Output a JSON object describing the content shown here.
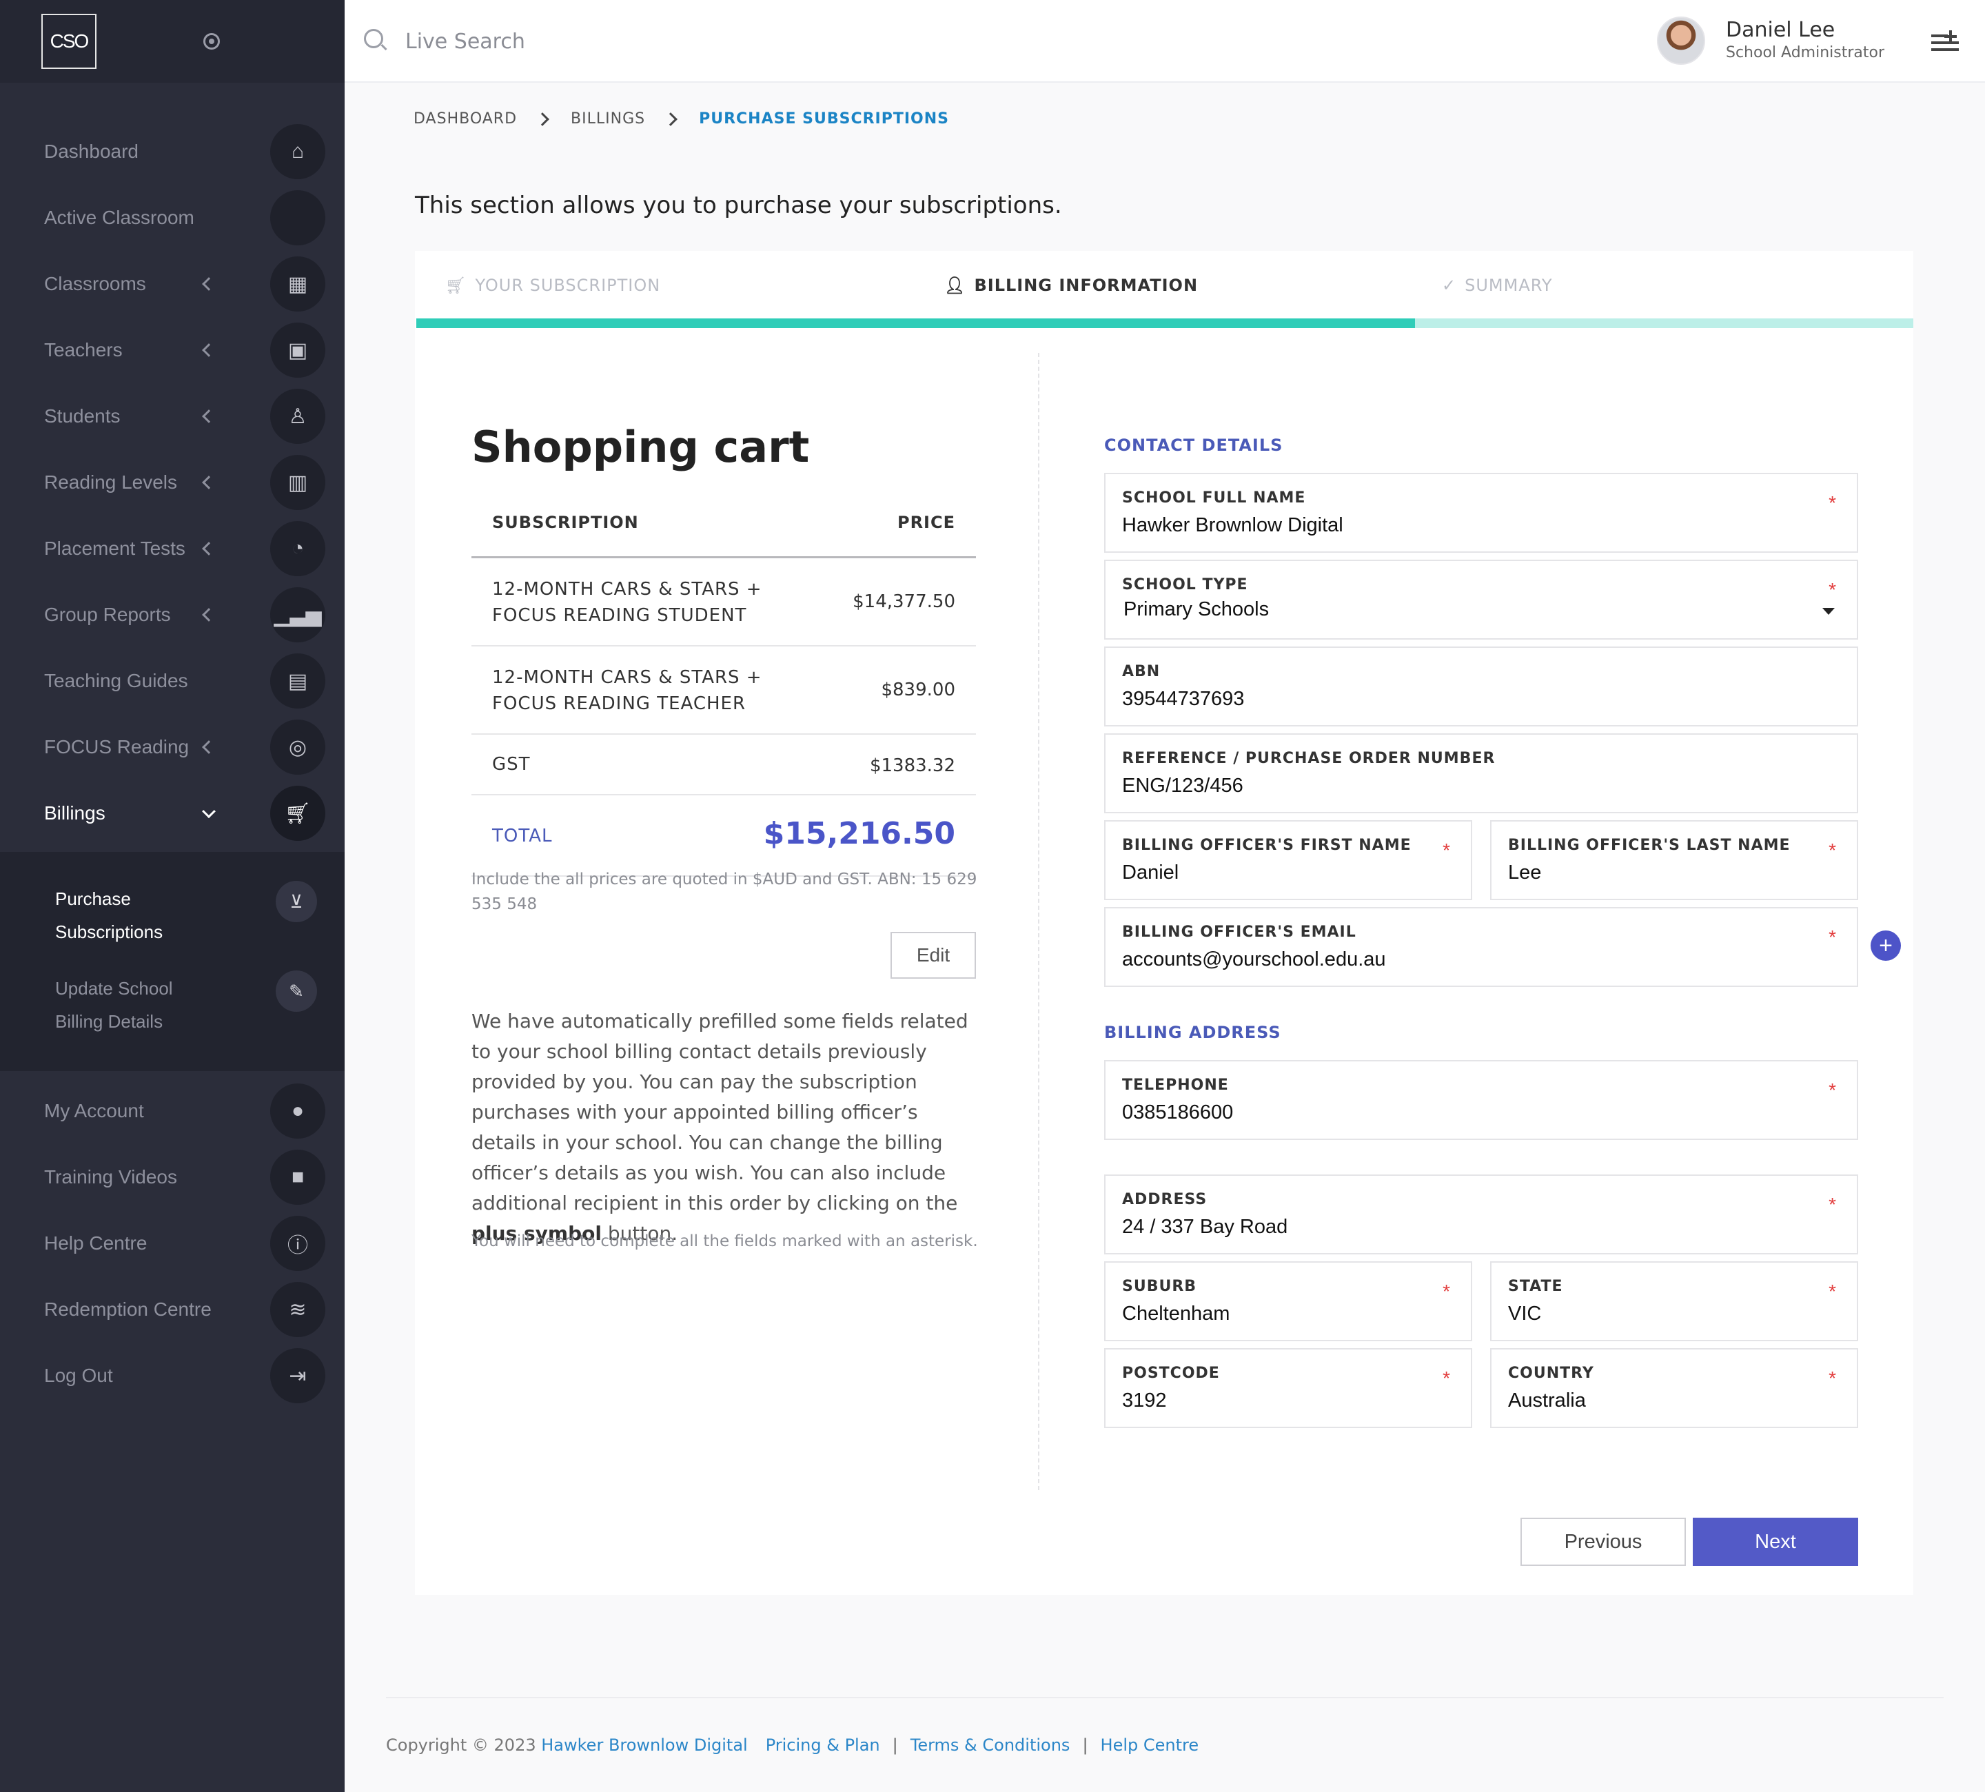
{
  "brand": {
    "logo_text": "CSO"
  },
  "search": {
    "placeholder": "Live Search"
  },
  "user": {
    "name": "Daniel Lee",
    "role": "School Administrator"
  },
  "sidebar": {
    "items": [
      {
        "label": "Dashboard",
        "icon": "home-icon",
        "has_chevron": false
      },
      {
        "label": "Active Classroom",
        "icon": "classroom-active-icon",
        "has_chevron": false
      },
      {
        "label": "Classrooms",
        "icon": "classrooms-icon",
        "has_chevron": true
      },
      {
        "label": "Teachers",
        "icon": "teacher-icon",
        "has_chevron": true
      },
      {
        "label": "Students",
        "icon": "student-icon",
        "has_chevron": true
      },
      {
        "label": "Reading Levels",
        "icon": "book-icon",
        "has_chevron": true
      },
      {
        "label": "Placement Tests",
        "icon": "test-icon",
        "has_chevron": true
      },
      {
        "label": "Group Reports",
        "icon": "chart-icon",
        "has_chevron": true
      },
      {
        "label": "Teaching Guides",
        "icon": "guides-icon",
        "has_chevron": false
      },
      {
        "label": "FOCUS Reading",
        "icon": "target-icon",
        "has_chevron": true
      },
      {
        "label": "Billings",
        "icon": "cart-icon",
        "has_chevron": true
      }
    ],
    "billing_sub": [
      {
        "line1": "Purchase",
        "line2": "Subscriptions",
        "icon": "basket-icon"
      },
      {
        "line1": "Update School",
        "line2": "Billing Details",
        "icon": "pencil-icon"
      }
    ],
    "lower_items": [
      {
        "label": "My Account",
        "icon": "account-icon"
      },
      {
        "label": "Training Videos",
        "icon": "video-icon"
      },
      {
        "label": "Help Centre",
        "icon": "info-icon"
      },
      {
        "label": "Redemption Centre",
        "icon": "handshake-icon"
      },
      {
        "label": "Log Out",
        "icon": "logout-icon"
      }
    ]
  },
  "breadcrumb": {
    "items": [
      "DASHBOARD",
      "BILLINGS",
      "PURCHASE SUBSCRIPTIONS"
    ]
  },
  "intro": "This section allows you to purchase your subscriptions.",
  "steps": {
    "items": [
      {
        "label": "YOUR SUBSCRIPTION",
        "icon": "cart-icon",
        "state": "done"
      },
      {
        "label": "BILLING INFORMATION",
        "icon": "user-icon",
        "state": "current"
      },
      {
        "label": "SUMMARY",
        "icon": "check-icon",
        "state": "pending"
      }
    ],
    "progress_fraction": 0.667
  },
  "cart": {
    "title": "Shopping cart",
    "headers": {
      "subscription": "SUBSCRIPTION",
      "price": "PRICE"
    },
    "rows": [
      {
        "name_line1": "12-MONTH CARS & STARS +",
        "name_line2": "FOCUS READING STUDENT",
        "price": "$14,377.50"
      },
      {
        "name_line1": "12-MONTH CARS & STARS +",
        "name_line2": "FOCUS READING TEACHER",
        "price": "$839.00"
      },
      {
        "name_line1": "GST",
        "name_line2": "",
        "price": "$1383.32"
      }
    ],
    "total_label": "TOTAL",
    "total_value": "$15,216.50",
    "fine_print": "Include the all prices are quoted in $AUD and GST. ABN: 15 629 535 548",
    "edit_label": "Edit",
    "prefill_text_1": "We have automatically prefilled some fields related to your school billing contact details previously provided by you. You can pay the subscription purchases with your appointed billing officer’s details in your school. You can change the billing officer’s details as you wish. You can also include additional recipient in this order by clicking on the ",
    "prefill_bold": "plus symbol",
    "prefill_text_2": " button.",
    "asterisk_note": "You will need to complete all the fields marked with an asterisk."
  },
  "form": {
    "contact_title": "CONTACT DETAILS",
    "billing_title": "BILLING ADDRESS",
    "school_name": {
      "label": "SCHOOL FULL NAME",
      "value": "Hawker Brownlow Digital",
      "required": "*"
    },
    "school_type": {
      "label": "SCHOOL TYPE",
      "value": "Primary Schools",
      "required": "*"
    },
    "abn": {
      "label": "ABN",
      "value": "39544737693"
    },
    "reference": {
      "label": "REFERENCE / PURCHASE ORDER NUMBER",
      "value": "ENG/123/456"
    },
    "first_name": {
      "label": "BILLING OFFICER'S FIRST NAME",
      "value": "Daniel",
      "required": "*"
    },
    "last_name": {
      "label": "BILLING OFFICER'S LAST NAME",
      "value": "Lee",
      "required": "*"
    },
    "email": {
      "label": "BILLING OFFICER'S EMAIL",
      "value": "accounts@yourschool.edu.au",
      "required": "*"
    },
    "add_symbol": "+",
    "telephone": {
      "label": "TELEPHONE",
      "value": "0385186600",
      "required": "*"
    },
    "address": {
      "label": "ADDRESS",
      "value": "24 / 337 Bay Road",
      "required": "*"
    },
    "suburb": {
      "label": "SUBURB",
      "value": "Cheltenham",
      "required": "*"
    },
    "state": {
      "label": "STATE",
      "value": "VIC",
      "required": "*"
    },
    "postcode": {
      "label": "POSTCODE",
      "value": "3192",
      "required": "*"
    },
    "country": {
      "label": "COUNTRY",
      "value": "Australia",
      "required": "*"
    },
    "previous_label": "Previous",
    "next_label": "Next"
  },
  "footer": {
    "copyright": "Copyright © 2023",
    "company": "Hawker Brownlow Digital",
    "links": [
      "Pricing & Plan",
      "Terms & Conditions",
      "Help Centre"
    ],
    "separator": "|"
  }
}
